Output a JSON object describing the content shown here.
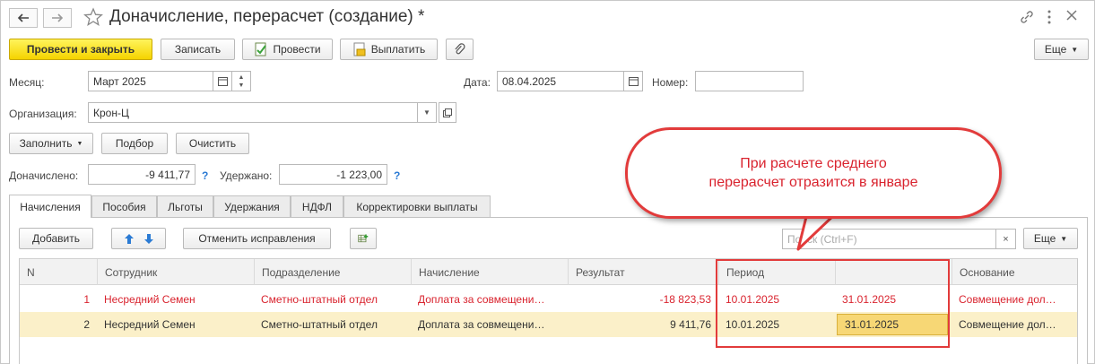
{
  "window": {
    "title": "Доначисление, перерасчет (создание) *",
    "nav_back_icon": "arrow-left-icon",
    "nav_forward_icon": "arrow-right-icon",
    "favorite_icon": "star-icon"
  },
  "toolbar": {
    "post_close": "Провести и закрыть",
    "save": "Записать",
    "post": "Провести",
    "pay": "Выплатить",
    "more": "Еще"
  },
  "fields": {
    "month_label": "Месяц:",
    "month_value": "Март 2025",
    "date_label": "Дата:",
    "date_value": "08.04.2025",
    "number_label": "Номер:",
    "number_value": "",
    "org_label": "Организация:",
    "org_value": "Крон-Ц"
  },
  "actions": {
    "fill": "Заполнить",
    "pick": "Подбор",
    "clear": "Очистить"
  },
  "totals": {
    "accrued_label": "Доначислено:",
    "accrued_value": "-9 411,77",
    "withheld_label": "Удержано:",
    "withheld_value": "-1 223,00",
    "help": "?"
  },
  "tabs": [
    "Начисления",
    "Пособия",
    "Льготы",
    "Удержания",
    "НДФЛ",
    "Корректировки выплаты"
  ],
  "table_toolbar": {
    "add": "Добавить",
    "cancel_corrections": "Отменить исправления",
    "search_placeholder": "Поиск (Ctrl+F)",
    "clear_search": "×",
    "more": "Еще"
  },
  "table": {
    "headers": [
      "N",
      "Сотрудник",
      "Подразделение",
      "Начисление",
      "Результат",
      "Период",
      "",
      "Основание"
    ],
    "rows": [
      [
        "1",
        "Несредний Семен",
        "Сметно-штатный отдел",
        "Доплата за совмещени…",
        "-18 823,53",
        "10.01.2025",
        "31.01.2025",
        "Совмещение дол…"
      ],
      [
        "2",
        "Несредний Семен",
        "Сметно-штатный отдел",
        "Доплата за совмещени…",
        "9 411,76",
        "10.01.2025",
        "31.01.2025",
        "Совмещение дол…"
      ]
    ]
  },
  "callout": {
    "line1": "При расчете среднего",
    "line2": "перерасчет отразится в  январе"
  },
  "colors": {
    "accent_yellow": "#f5d300",
    "error_red": "#d9232e",
    "selected_row": "#fbf0c9"
  }
}
